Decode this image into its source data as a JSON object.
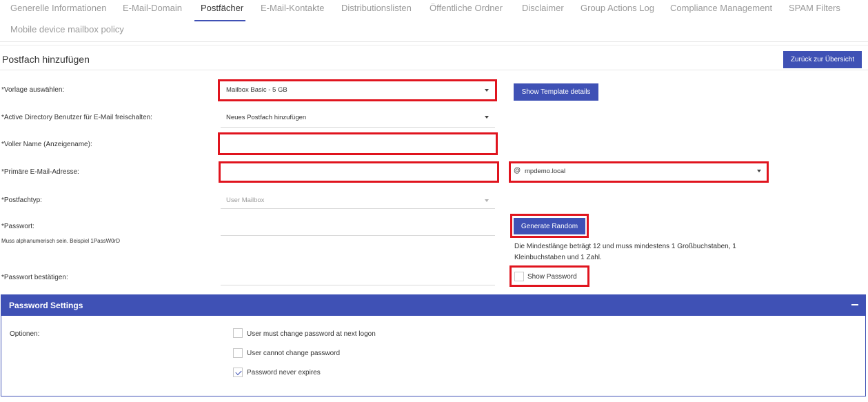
{
  "tabs": [
    {
      "label": "Generelle Informationen"
    },
    {
      "label": "E-Mail-Domain"
    },
    {
      "label": "Postfächer"
    },
    {
      "label": "E-Mail-Kontakte"
    },
    {
      "label": "Distributionslisten"
    },
    {
      "label": "Öffentliche Ordner"
    },
    {
      "label": "Disclaimer"
    },
    {
      "label": "Group Actions Log"
    },
    {
      "label": "Compliance Management"
    },
    {
      "label": "SPAM Filters"
    },
    {
      "label": "Mobile device mailbox policy"
    }
  ],
  "active_tab": "Postfächer",
  "page": {
    "title": "Postfach hinzufügen",
    "back_button": "Zurück zur Übersicht"
  },
  "form": {
    "template": {
      "label": "*Vorlage auswählen:",
      "value": "Mailbox Basic - 5 GB",
      "details_button": "Show Template details"
    },
    "ad_user": {
      "label": "*Active Directory Benutzer für E-Mail freischalten:",
      "value": "Neues Postfach hinzufügen"
    },
    "display_name": {
      "label": "*Voller Name (Anzeigename):",
      "value": ""
    },
    "email": {
      "label": "*Primäre E-Mail-Adresse:",
      "value": "",
      "at": "@",
      "domain": "mpdemo.local"
    },
    "mailbox_type": {
      "label": "*Postfachtyp:",
      "value": "User Mailbox"
    },
    "password": {
      "label": "*Passwort:",
      "hint": "Muss alphanumerisch sein. Beispiel 1PassW0rD",
      "value": "",
      "generate_button": "Generate Random",
      "requirements": "Die Mindestlänge beträgt 12 und muss mindestens 1 Großbuchstaben, 1 Kleinbuchstaben und 1 Zahl."
    },
    "password_confirm": {
      "label": "*Passwort bestätigen:",
      "value": "",
      "show_password": "Show Password",
      "show_password_checked": false
    }
  },
  "password_settings": {
    "title": "Password Settings",
    "options_label": "Optionen:",
    "options": [
      {
        "label": "User must change password at next logon",
        "checked": false
      },
      {
        "label": "User cannot change password",
        "checked": false
      },
      {
        "label": "Password never expires",
        "checked": true
      }
    ]
  },
  "colors": {
    "accent": "#3f51b5",
    "highlight": "#e0141e"
  }
}
